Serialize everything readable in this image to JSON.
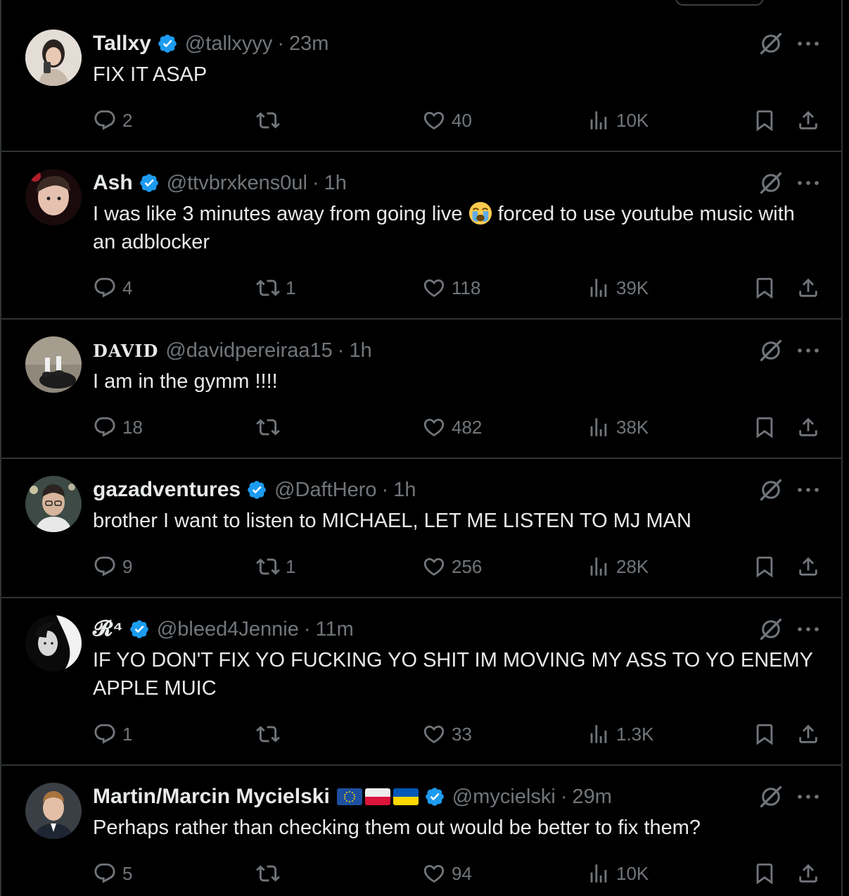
{
  "replies": [
    {
      "name": "Tallxy",
      "verified": true,
      "handle": "@tallxyyy",
      "time": "23m",
      "text": "FIX IT ASAP",
      "replies": "2",
      "reposts": "",
      "likes": "40",
      "views": "10K"
    },
    {
      "name": "Ash",
      "verified": true,
      "handle": "@ttvbrxkens0ul",
      "time": "1h",
      "text_before": "I was like 3 minutes away from going live",
      "emoji": "loudly-crying-face-emoji",
      "text_after": "forced to use youtube music with an adblocker",
      "replies": "4",
      "reposts": "1",
      "likes": "118",
      "views": "39K"
    },
    {
      "name": "DAVID",
      "verified": false,
      "handle": "@davidpereiraa15",
      "time": "1h",
      "text": "I am in the gymm !!!!",
      "replies": "18",
      "reposts": "",
      "likes": "482",
      "views": "38K"
    },
    {
      "name": "gazadventures",
      "verified": true,
      "handle": "@DaftHero",
      "time": "1h",
      "text": "brother I want to listen to MICHAEL, LET ME LISTEN TO MJ MAN",
      "replies": "9",
      "reposts": "1",
      "likes": "256",
      "views": "28K"
    },
    {
      "name": "𝓡⁴",
      "verified": true,
      "handle": "@bleed4Jennie",
      "time": "11m",
      "text": "IF YO DON'T FIX YO FUCKING YO SHIT IM MOVING MY ASS TO YO ENEMY APPLE MUIC",
      "replies": "1",
      "reposts": "",
      "likes": "33",
      "views": "1.3K"
    },
    {
      "name": "Martin/Marcin Mycielski",
      "verified": true,
      "handle": "@mycielski",
      "time": "29m",
      "text": "Perhaps rather than checking them out would be better to fix them?",
      "flags": [
        "eu-flag",
        "poland-flag",
        "ukraine-flag"
      ],
      "replies": "5",
      "reposts": "",
      "likes": "94",
      "views": "10K"
    }
  ],
  "separator": "·",
  "colors": {
    "background": "#000000",
    "text": "#e7e9ea",
    "muted": "#71767b",
    "border": "#2f3336",
    "verified": "#1d9bf0"
  }
}
